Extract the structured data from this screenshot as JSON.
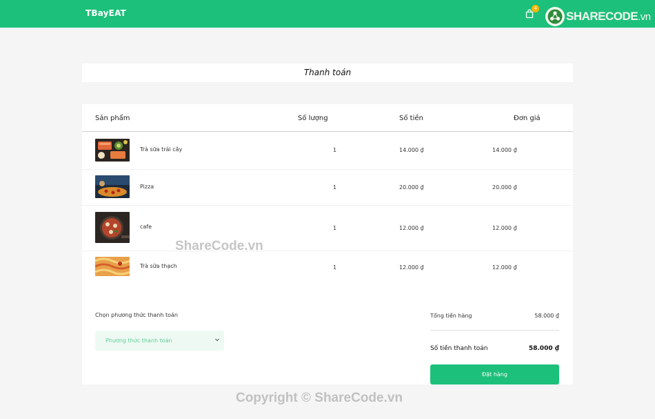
{
  "header": {
    "logo": "TBayEAT",
    "cart_count": "4",
    "brand_name": "SHARECODE",
    "brand_suffix": ".vn"
  },
  "page": {
    "title": "Thanh toán"
  },
  "table": {
    "columns": [
      "Sản phẩm",
      "Số lượng",
      "Số tiền",
      "Đơn giá"
    ],
    "rows": [
      {
        "name": "Trà sữa trái cây",
        "qty": "1",
        "amount": "14.000 ₫",
        "unit_price": "14.000 ₫",
        "image": "salmon-dish-photo"
      },
      {
        "name": "Pizza",
        "qty": "1",
        "amount": "20.000 ₫",
        "unit_price": "20.000 ₫",
        "image": "pizza-photo"
      },
      {
        "name": "cafe",
        "qty": "1",
        "amount": "12.000 ₫",
        "unit_price": "12.000 ₫",
        "image": "pan-dish-photo"
      },
      {
        "name": "Trà sữa thạch",
        "qty": "1",
        "amount": "12.000 ₫",
        "unit_price": "12.000 ₫",
        "image": "pasta-photo"
      }
    ]
  },
  "payment": {
    "label": "Chọn phương thức thanh toán",
    "placeholder": "Phương thức thanh toán"
  },
  "summary": {
    "subtotal_label": "Tổng tiền hàng",
    "subtotal_value": "58.000 ₫",
    "total_label": "Số tiền thanh toán",
    "total_value": "58.000 ₫",
    "order_button": "Đặt hàng"
  },
  "watermarks": {
    "center": "ShareCode.vn",
    "bottom": "Copyright © ShareCode.vn"
  },
  "colors": {
    "accent": "#1cc07a",
    "badge": "#f7b500",
    "select_bg": "#eef9f3"
  }
}
